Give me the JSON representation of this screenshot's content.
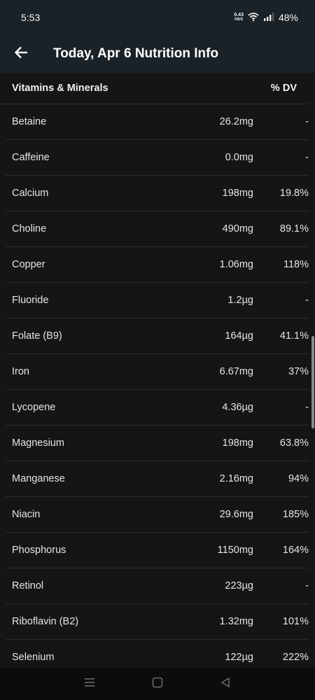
{
  "status_bar": {
    "time": "5:53",
    "net_speed_value": "0.43",
    "net_speed_unit": "KB/S",
    "battery": "48%"
  },
  "app_bar": {
    "title": "Today, Apr 6 Nutrition Info"
  },
  "table": {
    "header_label": "Vitamins & Minerals",
    "header_dv": "% DV",
    "rows": [
      {
        "name": "Betaine",
        "amount": "26.2mg",
        "dv": "-"
      },
      {
        "name": "Caffeine",
        "amount": "0.0mg",
        "dv": "-"
      },
      {
        "name": "Calcium",
        "amount": "198mg",
        "dv": "19.8%"
      },
      {
        "name": "Choline",
        "amount": "490mg",
        "dv": "89.1%"
      },
      {
        "name": "Copper",
        "amount": "1.06mg",
        "dv": "118%"
      },
      {
        "name": "Fluoride",
        "amount": "1.2µg",
        "dv": "-"
      },
      {
        "name": "Folate (B9)",
        "amount": "164µg",
        "dv": "41.1%"
      },
      {
        "name": "Iron",
        "amount": "6.67mg",
        "dv": "37%"
      },
      {
        "name": "Lycopene",
        "amount": "4.36µg",
        "dv": "-"
      },
      {
        "name": "Magnesium",
        "amount": "198mg",
        "dv": "63.8%"
      },
      {
        "name": "Manganese",
        "amount": "2.16mg",
        "dv": "94%"
      },
      {
        "name": "Niacin",
        "amount": "29.6mg",
        "dv": "185%"
      },
      {
        "name": "Phosphorus",
        "amount": "1150mg",
        "dv": "164%"
      },
      {
        "name": "Retinol",
        "amount": "223µg",
        "dv": "-"
      },
      {
        "name": "Riboflavin (B2)",
        "amount": "1.32mg",
        "dv": "101%"
      },
      {
        "name": "Selenium",
        "amount": "122µg",
        "dv": "222%"
      }
    ]
  },
  "icons": {
    "back": "arrow-left-icon",
    "wifi": "wifi-icon",
    "signal": "signal-icon",
    "nav_recents": "menu-lines-icon",
    "nav_home": "square-icon",
    "nav_back": "triangle-back-icon"
  },
  "colors": {
    "app_bar": "#1a2228",
    "background": "#151515",
    "text": "#e6e6e6",
    "divider": "#2c2c2c"
  }
}
